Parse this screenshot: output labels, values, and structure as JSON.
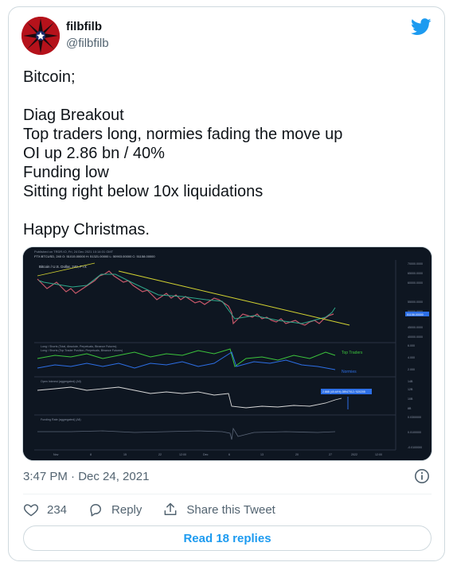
{
  "author": {
    "display_name": "filbfilb",
    "handle": "@filbfilb",
    "avatar_icon": "red-star-avatar"
  },
  "brand_icon": "twitter-bird-icon",
  "tweet": {
    "lines": [
      "Bitcoin;",
      "",
      "Diag Breakout",
      "Top traders long, normies fading the move up",
      "OI up 2.86 bn / 40%",
      "Funding low",
      "Sitting right below 10x liquidations",
      "",
      "Happy Christmas."
    ]
  },
  "media": {
    "chart_title": "Bitcoin / U.S. Dollar, 240, FTX",
    "published": "Published on TRDR.IO, Fri, 24 Dec 2021 10:14:01 GMT",
    "ohlc": "FTX:BTCUSD, 240 O: 51015.00000 H: 51321.00000 L: 50903.00000 C: 51158.00000",
    "panel2_title_1": "Long / Shorts (Total, Absolute, Perpetuals, Binance Futures)",
    "panel2_title_2": "Long / Shorts (Top Trader Position, Perpetuals, Binance Futures)",
    "top_traders_label": "Top Traders",
    "normies_label": "Normies",
    "oi_title": "Open Interest (aggregated) (All)",
    "funding_title": "Funding Rate (aggregated) (All)",
    "oi_callout": "2.86B (40.44%) 28947012 / 520205",
    "price_ticks": [
      "70000.0000",
      "65000.0000",
      "60000.0000",
      "55000.0000",
      "50000.0000",
      "45000.0000",
      "40000.0000"
    ],
    "price_marker": "51158.00000",
    "ls_ticks": [
      "6.000",
      "4.000",
      "2.000"
    ],
    "ls_left_ticks": [
      "1.000",
      "0.500",
      "1.000",
      "0.900"
    ],
    "oi_ticks": [
      "14B",
      "12B",
      "10B",
      "8B"
    ],
    "funding_ticks": [
      "0.0300000",
      "0.0100000",
      "-0.0100000"
    ],
    "x_ticks": [
      "Nov",
      "8",
      "15",
      "22",
      "12:00",
      "Dec",
      "6",
      "13",
      "20",
      "27",
      "2022",
      "12:00"
    ],
    "colors": {
      "background": "#0e1621",
      "top_traders": "#3cc43c",
      "normies": "#2d6fe6",
      "trendline": "#d4d431",
      "oi_line": "#d9d9d9"
    }
  },
  "meta": {
    "timestamp": "3:47 PM · Dec 24, 2021"
  },
  "actions": {
    "like_count": "234",
    "reply_label": "Reply",
    "share_label": "Share this Tweet"
  },
  "read_replies_label": "Read 18 replies"
}
